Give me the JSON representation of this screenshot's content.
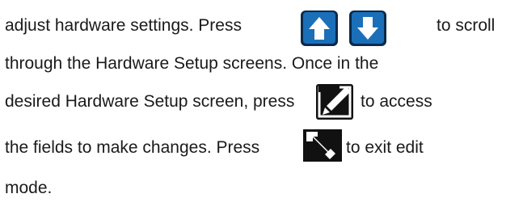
{
  "instructions": {
    "line1_before": "adjust hardware settings. Press",
    "line1_after": "to scroll",
    "line2": "through the Hardware Setup screens. Once in the",
    "line3_before": "desired Hardware Setup screen, press",
    "line3_after": "to access",
    "line4_before": "the fields to make changes. Press",
    "line4_after": "to exit edit",
    "line5": "mode."
  },
  "icons": {
    "up": "arrow-up-key-icon",
    "down": "arrow-down-key-icon",
    "edit": "edit-mode-key-icon",
    "exit_edit": "exit-edit-key-icon"
  },
  "colors": {
    "key_blue": "#1b6fb8",
    "key_dark": "#0a2a4a",
    "key_black": "#111111"
  }
}
